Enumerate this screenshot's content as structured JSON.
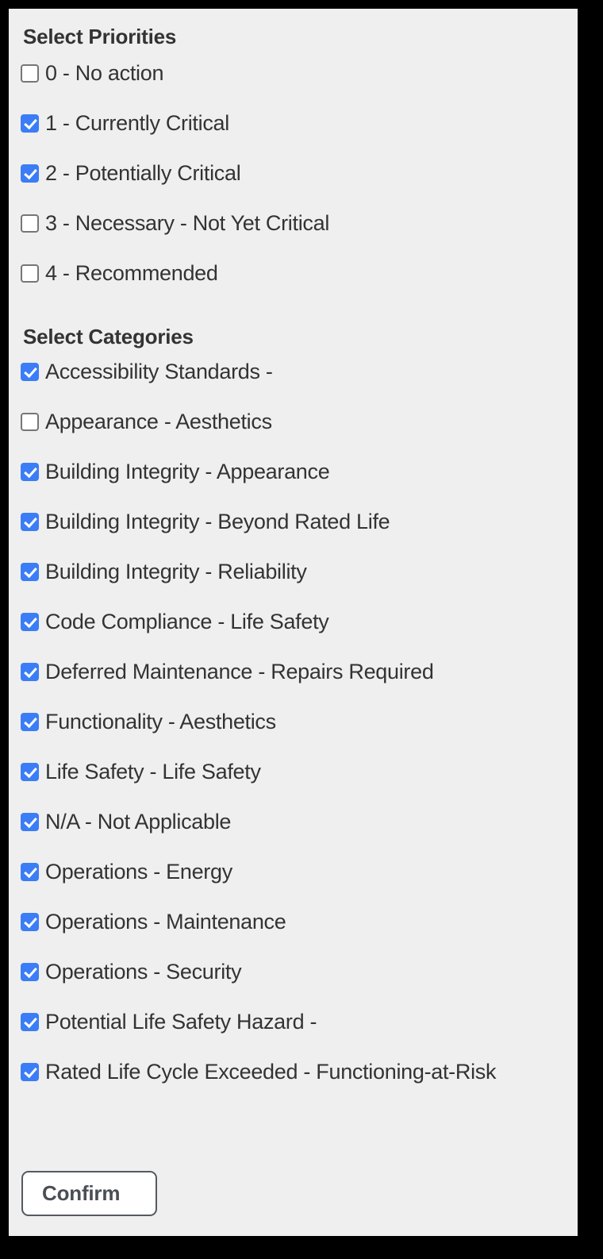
{
  "panel": {
    "background_color": "#efefef",
    "frame_color": "#000000",
    "accent_color": "#3b7df6"
  },
  "priorities": {
    "title": "Select Priorities",
    "items": [
      {
        "label": "0 - No action",
        "checked": false
      },
      {
        "label": "1 - Currently Critical",
        "checked": true
      },
      {
        "label": "2 - Potentially Critical",
        "checked": true
      },
      {
        "label": "3 - Necessary - Not Yet Critical",
        "checked": false
      },
      {
        "label": "4 - Recommended",
        "checked": false
      }
    ]
  },
  "categories": {
    "title": "Select Categories",
    "items": [
      {
        "label": "Accessibility Standards -",
        "checked": true
      },
      {
        "label": "Appearance - Aesthetics",
        "checked": false
      },
      {
        "label": "Building Integrity - Appearance",
        "checked": true
      },
      {
        "label": "Building Integrity - Beyond Rated Life",
        "checked": true
      },
      {
        "label": "Building Integrity - Reliability",
        "checked": true
      },
      {
        "label": "Code Compliance - Life Safety",
        "checked": true
      },
      {
        "label": "Deferred Maintenance - Repairs Required",
        "checked": true
      },
      {
        "label": "Functionality - Aesthetics",
        "checked": true
      },
      {
        "label": "Life Safety - Life Safety",
        "checked": true
      },
      {
        "label": "N/A - Not Applicable",
        "checked": true
      },
      {
        "label": "Operations - Energy",
        "checked": true
      },
      {
        "label": "Operations - Maintenance",
        "checked": true
      },
      {
        "label": "Operations - Security",
        "checked": true
      },
      {
        "label": "Potential Life Safety Hazard -",
        "checked": true
      },
      {
        "label": "Rated Life Cycle Exceeded - Functioning-at-Risk",
        "checked": true
      }
    ]
  },
  "actions": {
    "confirm_label": "Confirm"
  }
}
